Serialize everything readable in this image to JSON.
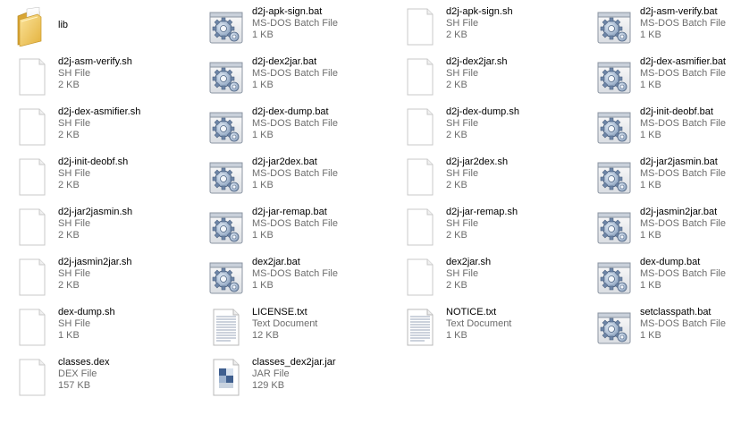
{
  "files": [
    {
      "name": "lib",
      "kind": "folder",
      "type": "",
      "size": ""
    },
    {
      "name": "d2j-apk-sign.bat",
      "kind": "bat",
      "type": "MS-DOS Batch File",
      "size": "1 KB"
    },
    {
      "name": "d2j-apk-sign.sh",
      "kind": "sh",
      "type": "SH File",
      "size": "2 KB"
    },
    {
      "name": "d2j-asm-verify.bat",
      "kind": "bat",
      "type": "MS-DOS Batch File",
      "size": "1 KB"
    },
    {
      "name": "d2j-asm-verify.sh",
      "kind": "sh",
      "type": "SH File",
      "size": "2 KB"
    },
    {
      "name": "d2j-dex2jar.bat",
      "kind": "bat",
      "type": "MS-DOS Batch File",
      "size": "1 KB"
    },
    {
      "name": "d2j-dex2jar.sh",
      "kind": "sh",
      "type": "SH File",
      "size": "2 KB"
    },
    {
      "name": "d2j-dex-asmifier.bat",
      "kind": "bat",
      "type": "MS-DOS Batch File",
      "size": "1 KB"
    },
    {
      "name": "d2j-dex-asmifier.sh",
      "kind": "sh",
      "type": "SH File",
      "size": "2 KB"
    },
    {
      "name": "d2j-dex-dump.bat",
      "kind": "bat",
      "type": "MS-DOS Batch File",
      "size": "1 KB"
    },
    {
      "name": "d2j-dex-dump.sh",
      "kind": "sh",
      "type": "SH File",
      "size": "2 KB"
    },
    {
      "name": "d2j-init-deobf.bat",
      "kind": "bat",
      "type": "MS-DOS Batch File",
      "size": "1 KB"
    },
    {
      "name": "d2j-init-deobf.sh",
      "kind": "sh",
      "type": "SH File",
      "size": "2 KB"
    },
    {
      "name": "d2j-jar2dex.bat",
      "kind": "bat",
      "type": "MS-DOS Batch File",
      "size": "1 KB"
    },
    {
      "name": "d2j-jar2dex.sh",
      "kind": "sh",
      "type": "SH File",
      "size": "2 KB"
    },
    {
      "name": "d2j-jar2jasmin.bat",
      "kind": "bat",
      "type": "MS-DOS Batch File",
      "size": "1 KB"
    },
    {
      "name": "d2j-jar2jasmin.sh",
      "kind": "sh",
      "type": "SH File",
      "size": "2 KB"
    },
    {
      "name": "d2j-jar-remap.bat",
      "kind": "bat",
      "type": "MS-DOS Batch File",
      "size": "1 KB"
    },
    {
      "name": "d2j-jar-remap.sh",
      "kind": "sh",
      "type": "SH File",
      "size": "2 KB"
    },
    {
      "name": "d2j-jasmin2jar.bat",
      "kind": "bat",
      "type": "MS-DOS Batch File",
      "size": "1 KB"
    },
    {
      "name": "d2j-jasmin2jar.sh",
      "kind": "sh",
      "type": "SH File",
      "size": "2 KB"
    },
    {
      "name": "dex2jar.bat",
      "kind": "bat",
      "type": "MS-DOS Batch File",
      "size": "1 KB"
    },
    {
      "name": "dex2jar.sh",
      "kind": "sh",
      "type": "SH File",
      "size": "2 KB"
    },
    {
      "name": "dex-dump.bat",
      "kind": "bat",
      "type": "MS-DOS Batch File",
      "size": "1 KB"
    },
    {
      "name": "dex-dump.sh",
      "kind": "sh",
      "type": "SH File",
      "size": "1 KB"
    },
    {
      "name": "LICENSE.txt",
      "kind": "txt",
      "type": "Text Document",
      "size": "12 KB"
    },
    {
      "name": "NOTICE.txt",
      "kind": "txt",
      "type": "Text Document",
      "size": "1 KB"
    },
    {
      "name": "setclasspath.bat",
      "kind": "bat",
      "type": "MS-DOS Batch File",
      "size": "1 KB"
    },
    {
      "name": "classes.dex",
      "kind": "sh",
      "type": "DEX File",
      "size": "157 KB"
    },
    {
      "name": "classes_dex2jar.jar",
      "kind": "jar",
      "type": "JAR File",
      "size": "129 KB"
    }
  ]
}
